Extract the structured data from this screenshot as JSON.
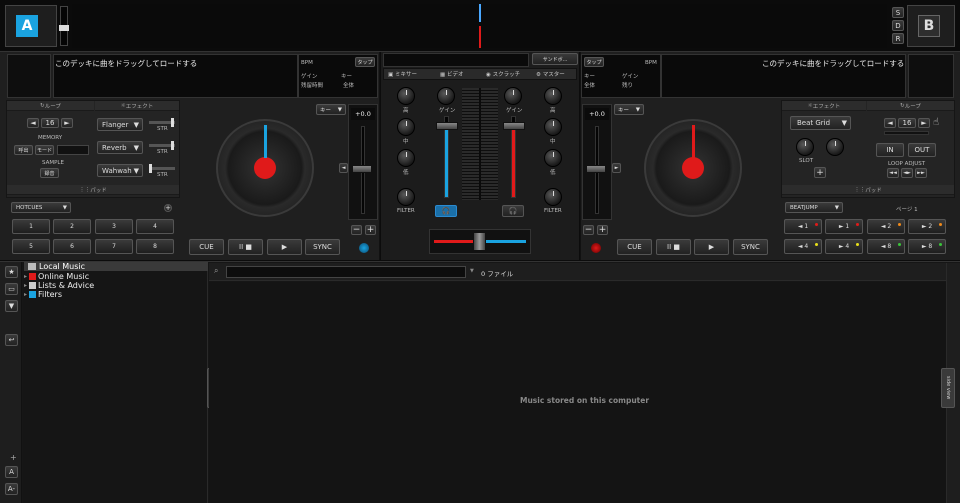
{
  "deck_a": {
    "letter": "A",
    "load_text": "このデッキに曲をドラッグしてロードする",
    "bpm_label": "BPM",
    "tap_label": "タップ",
    "gain_label": "ゲイン",
    "key_label": "キー",
    "remaining_label": "残留時間",
    "total_label": "全体",
    "loop_header": "ループ",
    "effect_header": "エフェクト",
    "loop_size": "16",
    "memory_label": "MEMORY",
    "recall_btn": "呼出",
    "mode_btn": "モード",
    "sample_label": "SAMPLE",
    "record_btn": "録音",
    "effects": [
      "Flanger",
      "Reverb",
      "Wahwah"
    ],
    "str_label": "STR",
    "pad_header": "パッド",
    "pad_mode": "HOTCUES",
    "pads": [
      "1",
      "2",
      "3",
      "4",
      "5",
      "6",
      "7",
      "8"
    ],
    "key_btn": "キー",
    "pitch": "+0.0",
    "cue": "CUE",
    "playpause": "II ■",
    "play": "▶",
    "sync": "SYNC"
  },
  "deck_b": {
    "letter": "B",
    "load_text": "このデッキに曲をドラッグしてロードする",
    "bpm_label": "BPM",
    "tap_label": "タップ",
    "gain_label": "ゲイン",
    "key_label": "キー",
    "remaining_label": "残り",
    "total_label": "全体",
    "side_buttons": [
      "S",
      "D",
      "R"
    ],
    "effect_header": "エフェクト",
    "loop_header": "ループ",
    "effect": "Beat Grid",
    "slot_label": "SLOT",
    "loop_size": "16",
    "in_btn": "IN",
    "out_btn": "OUT",
    "loop_adjust_label": "LOOP ADJUST",
    "pad_header": "パッド",
    "pad_mode": "BEATJUMP",
    "page_label": "ページ 1",
    "pads": [
      "◄ 1",
      "► 1",
      "◄ 2",
      "► 2",
      "◄ 4",
      "► 4",
      "◄ 8",
      "► 8"
    ],
    "key_btn": "キー",
    "pitch": "+0.0",
    "cue": "CUE",
    "playpause": "II ■",
    "play": "▶",
    "sync": "SYNC"
  },
  "mixer": {
    "settings_btn": "サンドボ...",
    "tabs": [
      "ミキサー",
      "ビデオ",
      "スクラッチ",
      "マスター"
    ],
    "gain_label": "ゲイン",
    "knob_labels": [
      "高",
      "中",
      "低"
    ],
    "filter_label": "FILTER"
  },
  "browser": {
    "tree": [
      "Local Music",
      "Online Music",
      "Lists & Advice",
      "Filters"
    ],
    "search_placeholder": "",
    "file_count": "0 ファイル",
    "empty_message": "Music stored on this computer",
    "folders_tab": "folders",
    "sideview_tab": "side view",
    "zoom_in": "A",
    "zoom_out": "A-"
  },
  "colors": {
    "deck_a": "#1aa3e0",
    "deck_b": "#e01a1a",
    "platter_label": "#e01a1a"
  }
}
